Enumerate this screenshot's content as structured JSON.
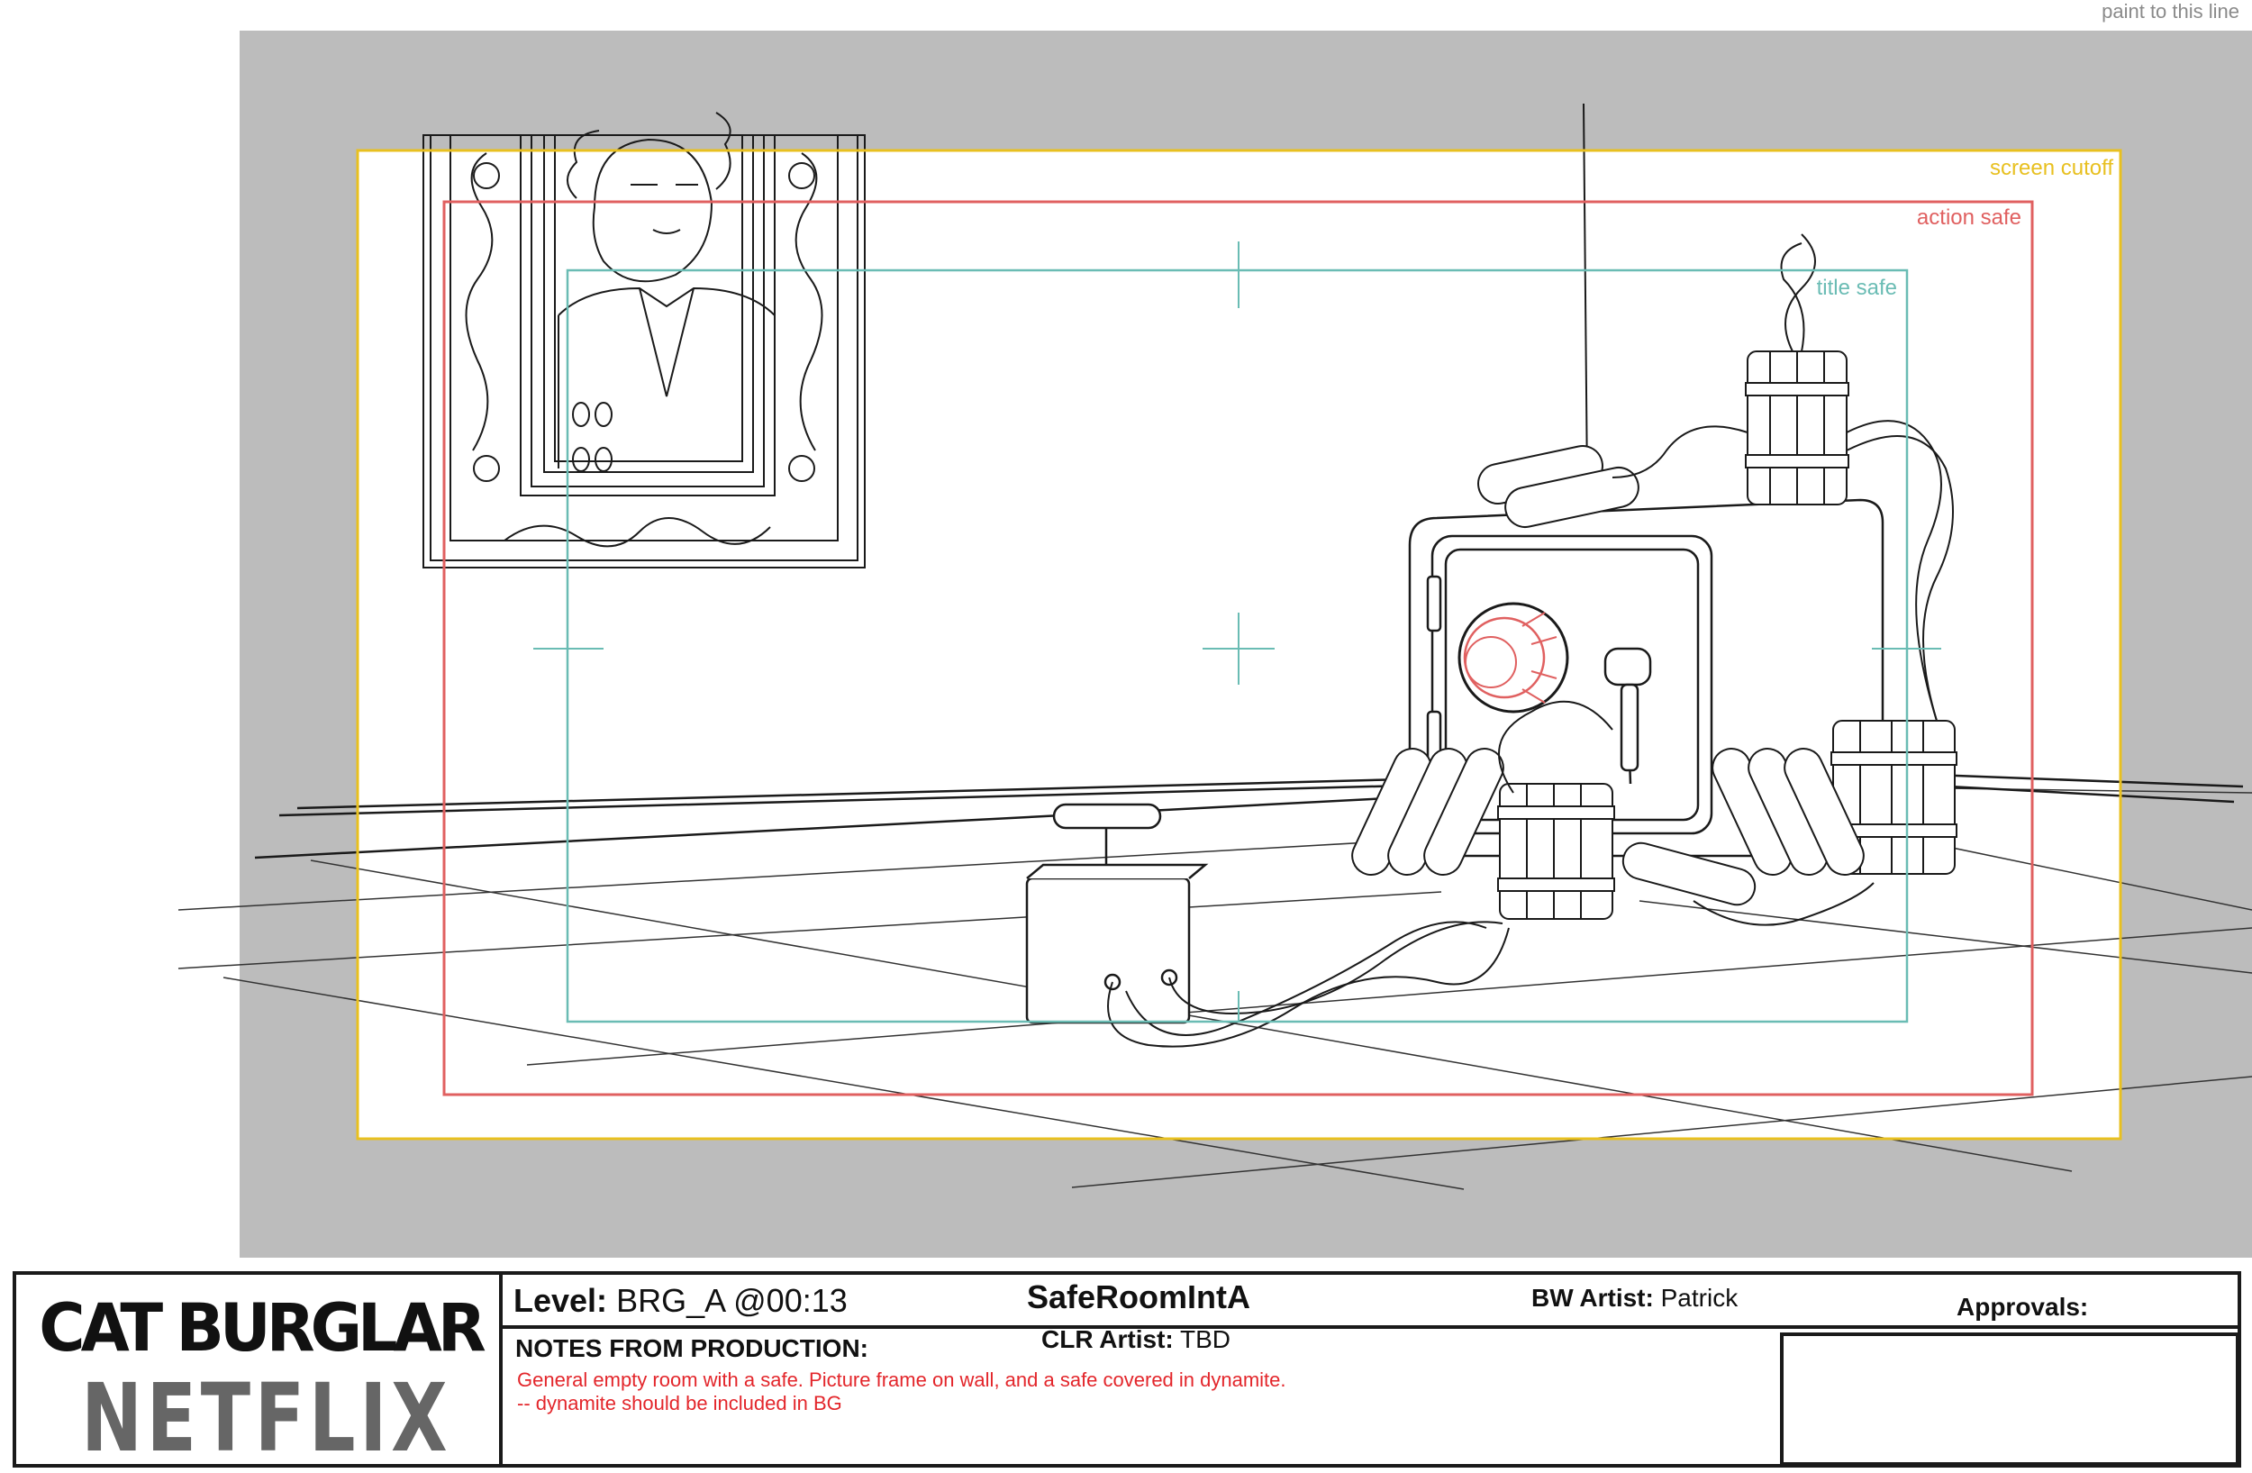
{
  "header": {
    "paint_label": "paint to this line"
  },
  "frame_labels": {
    "screen_cutoff": "screen cutoff",
    "action_safe": "action safe",
    "title_safe": "title safe"
  },
  "colors": {
    "background_gray": "#bcbcbc",
    "screen_cutoff": "#e8c020",
    "action_safe": "#e06060",
    "title_safe": "#6abcb4",
    "lens_red": "#e06060",
    "notes_red": "#e3262b"
  },
  "slate": {
    "logo_show": "CAT BURGLAR",
    "logo_network": "NETFLIX",
    "level_label": "Level:",
    "level_value": "BRG_A @00:13",
    "scene_name": "SafeRoomIntA",
    "bw_artist_label": "BW Artist:",
    "bw_artist_value": "Patrick",
    "clr_artist_label": "CLR Artist:",
    "clr_artist_value": "TBD",
    "approvals_label": "Approvals:",
    "notes_label": "NOTES FROM PRODUCTION:",
    "notes": [
      "General empty room with a safe. Picture frame on wall, and a safe covered in dynamite.",
      "-- dynamite should be included in BG"
    ]
  }
}
